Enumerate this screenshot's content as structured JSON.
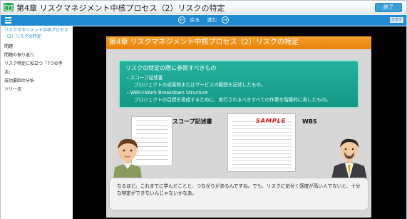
{
  "window": {
    "title": "第4章 リスクマネジメント中核プロセス（2）リスクの特定",
    "end_button": "終了"
  },
  "navbar": {
    "prev_label": "戻る",
    "next_label": "進む",
    "hide_tag": "非表示"
  },
  "sidebar": {
    "items": [
      {
        "label": "リスクマネジメント中核プロセス（2）リスクの特定",
        "active": true
      },
      {
        "label": "問題",
        "active": false
      },
      {
        "label": "問題の振り返り",
        "active": false
      },
      {
        "label": "リスク特定に役立つ「7つの手法」",
        "active": false
      },
      {
        "label": "成功要因の分析",
        "active": false
      },
      {
        "label": "ツリー法",
        "active": false
      }
    ]
  },
  "slide": {
    "header": "第4章 リスクマネジメント中核プロセス（2）リスクの特定",
    "box": {
      "title": "リスクの特定の際に参照すべきもの",
      "bullet1": "・スコープ記述書",
      "bullet1_sub": "プロジェクトの成果物またはサービスの範囲を記述したもの。",
      "bullet2": "・WBS=Work Breakdown Structure",
      "bullet2_sub": "プロジェクトの目標を達成するために、実行されるべきすべての作業を階層的に表したもの。"
    },
    "scope_label": "スコープ記述書",
    "sample_stamp": "SAMPLE",
    "wbs_label": "WBS",
    "speech": "なるほど。これまでに学んだことと、つながりがあるんですね。でも、リスクに気付く感度が高い人でないと、十分な特定ができないんじゃないかなあ。"
  },
  "colors": {
    "accent": "#1f8ad2",
    "slide_header": "#f39a1e",
    "green_box": "#1aa592"
  }
}
